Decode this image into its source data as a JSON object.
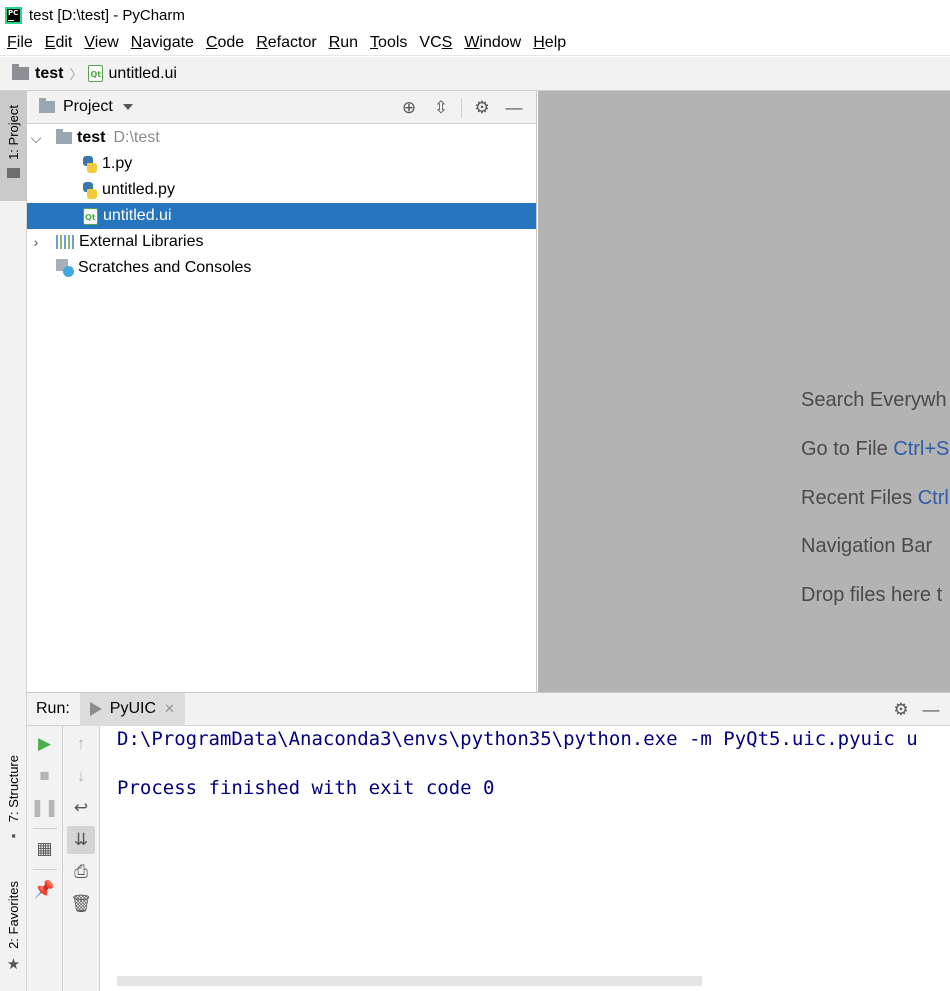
{
  "window": {
    "title": "test [D:\\test] - PyCharm",
    "logo_text": "PC"
  },
  "menu": [
    {
      "mn": "F",
      "rest": "ile"
    },
    {
      "mn": "E",
      "rest": "dit"
    },
    {
      "mn": "V",
      "rest": "iew"
    },
    {
      "mn": "N",
      "rest": "avigate"
    },
    {
      "mn": "C",
      "rest": "ode"
    },
    {
      "mn": "R",
      "rest": "efactor"
    },
    {
      "mn": "R",
      "rest": "un"
    },
    {
      "mn": "T",
      "rest": "ools"
    },
    {
      "pre": "VC",
      "mn": "S",
      "rest": ""
    },
    {
      "mn": "W",
      "rest": "indow"
    },
    {
      "mn": "H",
      "rest": "elp"
    }
  ],
  "breadcrumb": {
    "project": "test",
    "file": "untitled.ui"
  },
  "left_strip": {
    "project_tab": "1: Project",
    "structure_tab": "7: Structure",
    "favorites_tab": "2: Favorites"
  },
  "project_panel": {
    "title": "Project",
    "tree": {
      "root_name": "test",
      "root_path": "D:\\test",
      "files": [
        "1.py",
        "untitled.py",
        "untitled.ui"
      ],
      "external_libraries": "External Libraries",
      "scratches": "Scratches and Consoles"
    }
  },
  "editor_hints": [
    {
      "text": "Search Everywh",
      "key": ""
    },
    {
      "text": "Go to File ",
      "key": "Ctrl+S"
    },
    {
      "text": "Recent Files ",
      "key": "Ctrl"
    },
    {
      "text": "Navigation Bar ",
      "key": ""
    },
    {
      "text": "Drop files here t",
      "key": ""
    }
  ],
  "run_panel": {
    "label": "Run:",
    "tab": "PyUIC",
    "console": [
      "D:\\ProgramData\\Anaconda3\\envs\\python35\\python.exe -m PyQt5.uic.pyuic u",
      "Process finished with exit code 0"
    ]
  },
  "colors": {
    "selection": "#2675bf",
    "console_text": "#000080",
    "editor_bg": "#b3b3b3",
    "shortcut": "#2e5ca8"
  }
}
